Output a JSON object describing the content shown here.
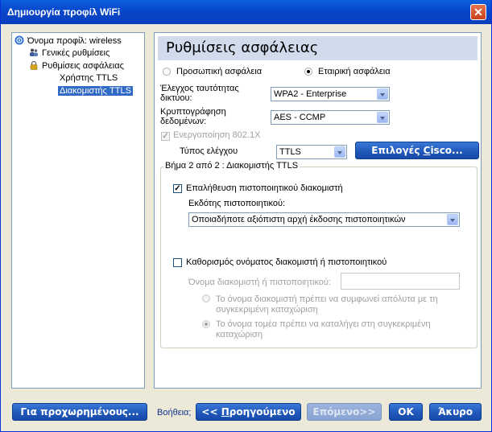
{
  "window": {
    "title": "Δημιουργία προφίλ WiFi",
    "close_symbol": "✕"
  },
  "tree": {
    "items": [
      {
        "label": "Όνομα προφίλ: wireless"
      },
      {
        "label": "Γενικές ρυθμίσεις"
      },
      {
        "label": "Ρυθμίσεις ασφάλειας"
      },
      {
        "label": "Χρήστης TTLS"
      },
      {
        "label": "Διακομιστής TTLS"
      }
    ]
  },
  "panel": {
    "title": "Ρυθμίσεις ασφάλειας",
    "radio_personal": "Προσωπική ασφάλεια",
    "radio_enterprise": "Εταιρική ασφάλεια",
    "auth_label_1": "Έλεγχος ταυτότητας",
    "auth_label_2": "δικτύου:",
    "auth_value": "WPA2 - Enterprise",
    "enc_label_1": "Κρυπτογράφηση",
    "enc_label_2": "δεδομένων:",
    "enc_value": "AES - CCMP",
    "enable_8021x": "Ενεργοποίηση 802.1X",
    "check_type_label": "Τύπος ελέγχου",
    "check_type_value": "TTLS",
    "cisco_options_prefix": "Επιλογές ",
    "cisco_options_ul": "C",
    "cisco_options_suffix": "isco...",
    "group_title": "Βήμα 2 από 2 : Διακομιστής TTLS",
    "validate_server": "Επαλήθευση πιστοποιητικού διακομιστή",
    "cert_issuer_label": "Εκδότης πιστοποιητικού:",
    "cert_issuer_value": "Οποιαδήποτε αξιόπιστη αρχή έκδοσης πιστοποιητικών",
    "specify_name": "Καθορισμός ονόματος διακομιστή ή πιστοποιητικού",
    "server_name_label": "Όνομα διακομιστή ή πιστοποιητικού:",
    "server_name_value": "",
    "exact_match_1": "Το όνομα διακομιστή πρέπει να συμφωνεί απόλυτα με τη",
    "exact_match_2": "συγκεκριμένη καταχώριση",
    "domain_match_1": "Το όνομα τομέα πρέπει να καταλήγει στη συγκεκριμένη",
    "domain_match_2": "καταχώριση"
  },
  "footer": {
    "advanced": "Για προχωρημένους...",
    "help": "Βοήθεια;",
    "back_prefix": "<< ",
    "back_ul": "Π",
    "back_suffix": "ροηγούμενο",
    "next": "Επόμενο>>",
    "ok": "OK",
    "cancel": "Άκυρο"
  },
  "colors": {
    "title_bar": "#0a52d6",
    "selection": "#316ac5",
    "header_band": "#d2dbeb",
    "button": "#1e56b8"
  }
}
